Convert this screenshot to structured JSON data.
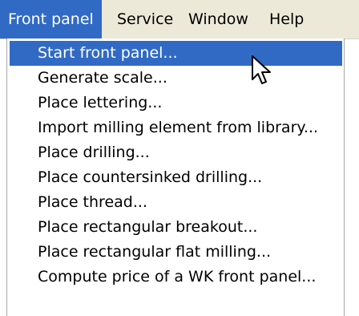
{
  "menubar": {
    "items": [
      {
        "label": "Front panel",
        "active": true
      },
      {
        "label": "Service",
        "active": false
      },
      {
        "label": "Window",
        "active": false
      },
      {
        "label": "Help",
        "active": false
      }
    ]
  },
  "dropdown": {
    "items": [
      {
        "label": "Start front panel...",
        "highlighted": true
      },
      {
        "label": "Generate scale...",
        "highlighted": false
      },
      {
        "label": "Place lettering...",
        "highlighted": false
      },
      {
        "label": "Import milling element from library...",
        "highlighted": false
      },
      {
        "label": "Place drilling...",
        "highlighted": false
      },
      {
        "label": "Place countersinked drilling...",
        "highlighted": false
      },
      {
        "label": "Place thread...",
        "highlighted": false
      },
      {
        "label": "Place rectangular breakout...",
        "highlighted": false
      },
      {
        "label": "Place rectangular flat milling...",
        "highlighted": false
      },
      {
        "label": "Compute price of a WK front panel...",
        "highlighted": false
      }
    ]
  },
  "colors": {
    "menubar_bg": "#ece9d8",
    "highlight": "#316ac5",
    "highlight_text": "#ffffff"
  },
  "cursor": {
    "icon": "arrow-cursor-icon"
  }
}
